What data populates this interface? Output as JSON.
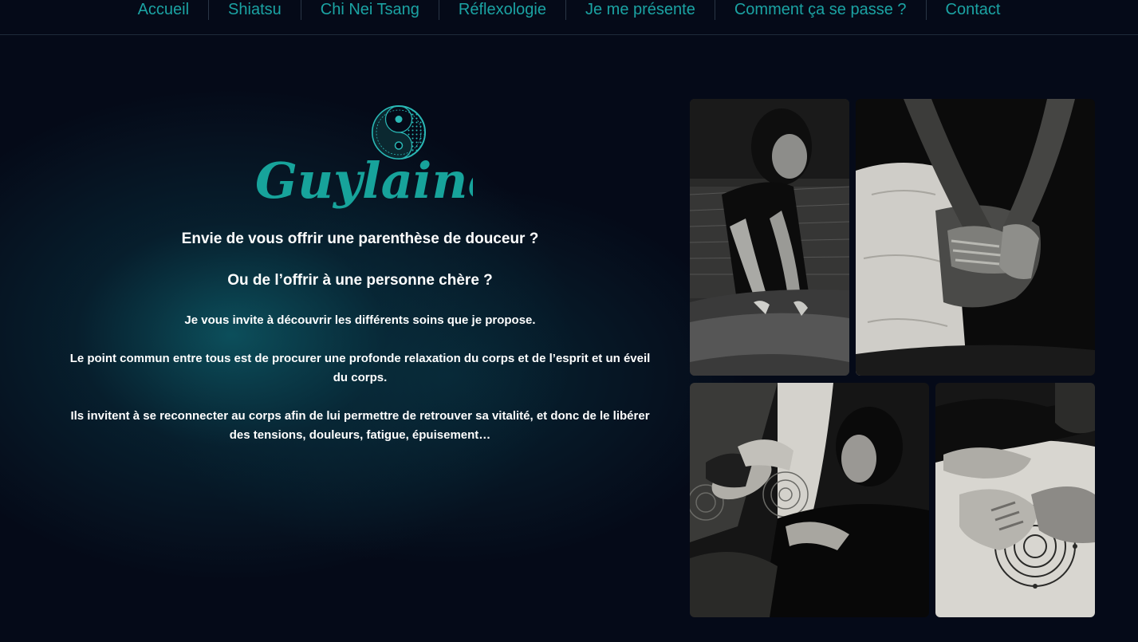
{
  "nav": {
    "items": [
      {
        "label": "Accueil"
      },
      {
        "label": "Shiatsu"
      },
      {
        "label": "Chi Nei Tsang"
      },
      {
        "label": "Réflexologie"
      },
      {
        "label": "Je me présente"
      },
      {
        "label": "Comment ça se passe ?"
      },
      {
        "label": "Contact"
      }
    ]
  },
  "logo": {
    "text": "Guylaine",
    "icon": "yin-yang-mandala-icon",
    "color": "#17a39b"
  },
  "intro": {
    "heading1": "Envie de vous offrir une parenthèse de douceur ?",
    "heading2": "Ou de l’offrir à une personne chère ?",
    "paragraph1": "Je vous invite à découvrir les différents soins que je propose.",
    "paragraph2": "Le point commun entre tous est de procurer une profonde relaxation du corps et de l’esprit et un éveil du corps.",
    "paragraph3": "Ils invitent à se reconnecter au corps afin de lui permettre de retrouver sa vitalité, et donc de le libérer des tensions, douleurs, fatigue, épuisement…"
  },
  "gallery": {
    "photos": [
      {
        "subject": "practitioner-massaging-back-photo"
      },
      {
        "subject": "hands-on-back-photo"
      },
      {
        "subject": "head-massage-photo"
      },
      {
        "subject": "foot-massage-photo"
      }
    ]
  },
  "colors": {
    "accent": "#1ba3a3",
    "background": "#050a18",
    "text": "#ffffff"
  }
}
